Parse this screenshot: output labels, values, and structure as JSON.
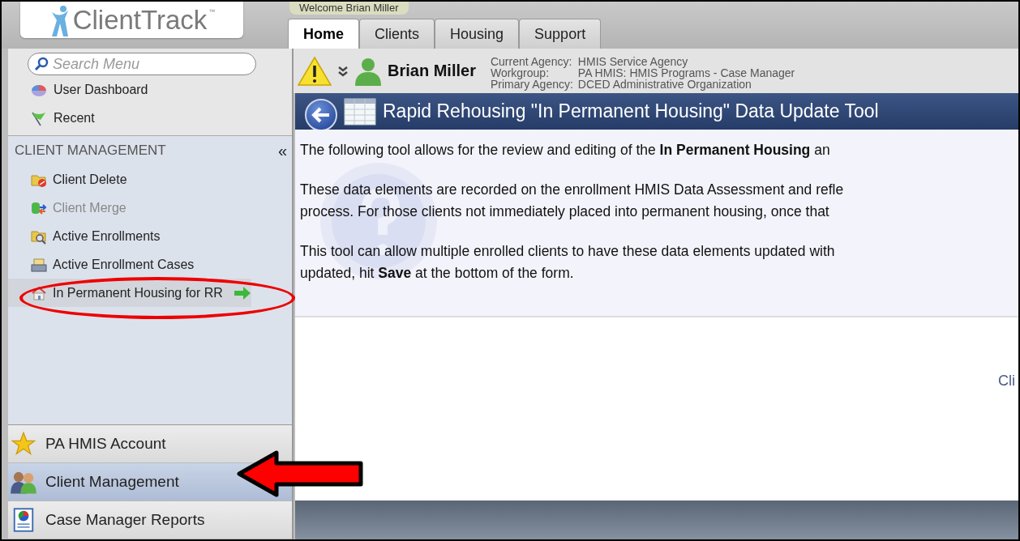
{
  "header": {
    "logo": "ClientTrack",
    "trademark": "™",
    "welcome": "Welcome Brian Miller"
  },
  "tabs": [
    {
      "label": "Home",
      "selected": true
    },
    {
      "label": "Clients",
      "selected": false
    },
    {
      "label": "Housing",
      "selected": false
    },
    {
      "label": "Support",
      "selected": false
    }
  ],
  "sidebar": {
    "search": {
      "placeholder": "Search Menu"
    },
    "quick_links": [
      {
        "label": "User Dashboard",
        "kind": "dashboard"
      },
      {
        "label": "Recent",
        "kind": "flag"
      }
    ],
    "section": {
      "title": "CLIENT MANAGEMENT",
      "collapse": "«"
    },
    "items": [
      {
        "label": "Client Delete",
        "kind": "delete",
        "disabled": false,
        "selected": false
      },
      {
        "label": "Client Merge",
        "kind": "merge",
        "disabled": true,
        "selected": false
      },
      {
        "label": "Active Enrollments",
        "kind": "search-folder",
        "disabled": false,
        "selected": false
      },
      {
        "label": "Active Enrollment Cases",
        "kind": "cases",
        "disabled": false,
        "selected": false
      },
      {
        "label": "In Permanent Housing for RR",
        "kind": "house",
        "disabled": false,
        "selected": true
      }
    ],
    "nav": [
      {
        "label": "PA HMIS Account",
        "kind": "star",
        "selected": false
      },
      {
        "label": "Client Management",
        "kind": "people",
        "selected": true
      },
      {
        "label": "Case Manager Reports",
        "kind": "report",
        "selected": false
      }
    ]
  },
  "user_bar": {
    "name": "Brian Miller",
    "details": [
      {
        "label": "Current Agency:",
        "value": "HMIS Service Agency"
      },
      {
        "label": "Workgroup:",
        "value": "PA HMIS: HMIS Programs - Case Manager"
      },
      {
        "label": "Primary Agency:",
        "value": "DCED Administrative Organization"
      }
    ]
  },
  "panel": {
    "title": "Rapid Rehousing \"In Permanent Housing\" Data Update Tool",
    "paragraphs": [
      [
        "The following tool allows for the review and editing of the **In Permanent Housing** an"
      ],
      [
        "These data elements are recorded on the enrollment HMIS Data Assessment and refle",
        "process.   For those clients not immediately placed into permanent housing, once that"
      ],
      [
        "This tool can allow multiple enrolled clients to have these data elements updated with",
        "updated, hit **Save** at the bottom of the form."
      ]
    ],
    "side_text": "Cli"
  }
}
